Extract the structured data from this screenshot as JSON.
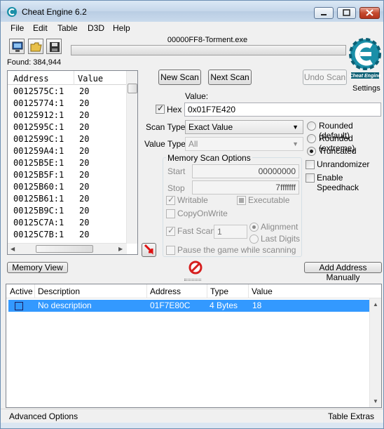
{
  "window": {
    "title": "Cheat Engine 6.2"
  },
  "menu": [
    "File",
    "Edit",
    "Table",
    "D3D",
    "Help"
  ],
  "toolbar": {
    "process_name": "00000FF8-Torment.exe",
    "found": "Found: 384,944",
    "settings_label": "Settings",
    "logo_text": "Cheat Engine"
  },
  "results": {
    "headers": {
      "address": "Address",
      "value": "Value"
    },
    "rows": [
      {
        "address": "0012575C:1",
        "value": "20"
      },
      {
        "address": "00125774:1",
        "value": "20"
      },
      {
        "address": "00125912:1",
        "value": "20"
      },
      {
        "address": "0012595C:1",
        "value": "20"
      },
      {
        "address": "0012599C:1",
        "value": "20"
      },
      {
        "address": "001259A4:1",
        "value": "20"
      },
      {
        "address": "00125B5E:1",
        "value": "20"
      },
      {
        "address": "00125B5F:1",
        "value": "20"
      },
      {
        "address": "00125B60:1",
        "value": "20"
      },
      {
        "address": "00125B61:1",
        "value": "20"
      },
      {
        "address": "00125B9C:1",
        "value": "20"
      },
      {
        "address": "00125C7A:1",
        "value": "20"
      },
      {
        "address": "00125C7B:1",
        "value": "20"
      }
    ]
  },
  "scan": {
    "new_scan": "New Scan",
    "next_scan": "Next Scan",
    "undo_scan": "Undo Scan",
    "value_label": "Value:",
    "hex_label": "Hex",
    "value": "0x01F7E420",
    "scan_type_label": "Scan Type",
    "scan_type": "Exact Value",
    "value_type_label": "Value Type",
    "value_type": "All",
    "rounding": {
      "rounded_default": "Rounded (default)",
      "rounded_extreme": "Rounded (extreme)",
      "truncated": "Truncated"
    },
    "unrandomizer": "Unrandomizer",
    "enable_speedhack": "Enable Speedhack"
  },
  "memory_scan_options": {
    "title": "Memory Scan Options",
    "start_label": "Start",
    "start_value": "00000000",
    "stop_label": "Stop",
    "stop_value": "7fffffff",
    "writable": "Writable",
    "executable": "Executable",
    "copy_on_write": "CopyOnWrite",
    "fast_scan": "Fast Scan",
    "fast_scan_value": "1",
    "alignment": "Alignment",
    "last_digits": "Last Digits",
    "pause_game": "Pause the game while scanning"
  },
  "buttons": {
    "memory_view": "Memory View",
    "add_address_manually": "Add Address Manually"
  },
  "address_list": {
    "headers": {
      "active": "Active",
      "description": "Description",
      "address": "Address",
      "type": "Type",
      "value": "Value"
    },
    "rows": [
      {
        "description": "No description",
        "address": "01F7E80C",
        "type": "4 Bytes",
        "value": "18"
      }
    ]
  },
  "status": {
    "advanced_options": "Advanced Options",
    "table_extras": "Table Extras"
  },
  "colors": {
    "selection": "#3399ff",
    "logo": "#1a8fa8",
    "stop_icon": "#d61f1f"
  }
}
